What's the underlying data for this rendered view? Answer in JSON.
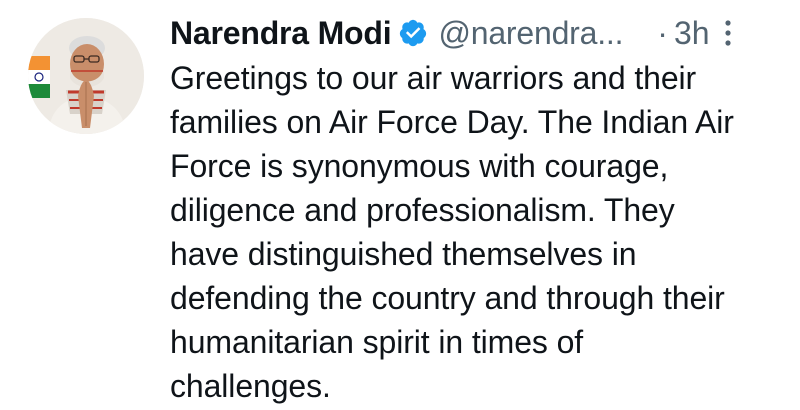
{
  "author": {
    "name": "Narendra Modi",
    "handle": "@narendra...",
    "time_separator": "·",
    "time": "3h",
    "avatar_icon": "profile-photo-avatar",
    "verified_icon": "verified-badge-icon",
    "more_icon": "more-options-icon"
  },
  "tweet": {
    "lines": [
      "Greetings to our air warriors and their",
      "families on Air Force Day. The Indian Air",
      "Force is synonymous with courage,",
      "diligence and professionalism. They",
      "have distinguished themselves in",
      "defending the country and through their",
      "humanitarian spirit in times of",
      "challenges."
    ]
  },
  "colors": {
    "text": "#0f1419",
    "secondary": "#536471",
    "verified": "#1d9bf0",
    "background": "#ffffff"
  }
}
